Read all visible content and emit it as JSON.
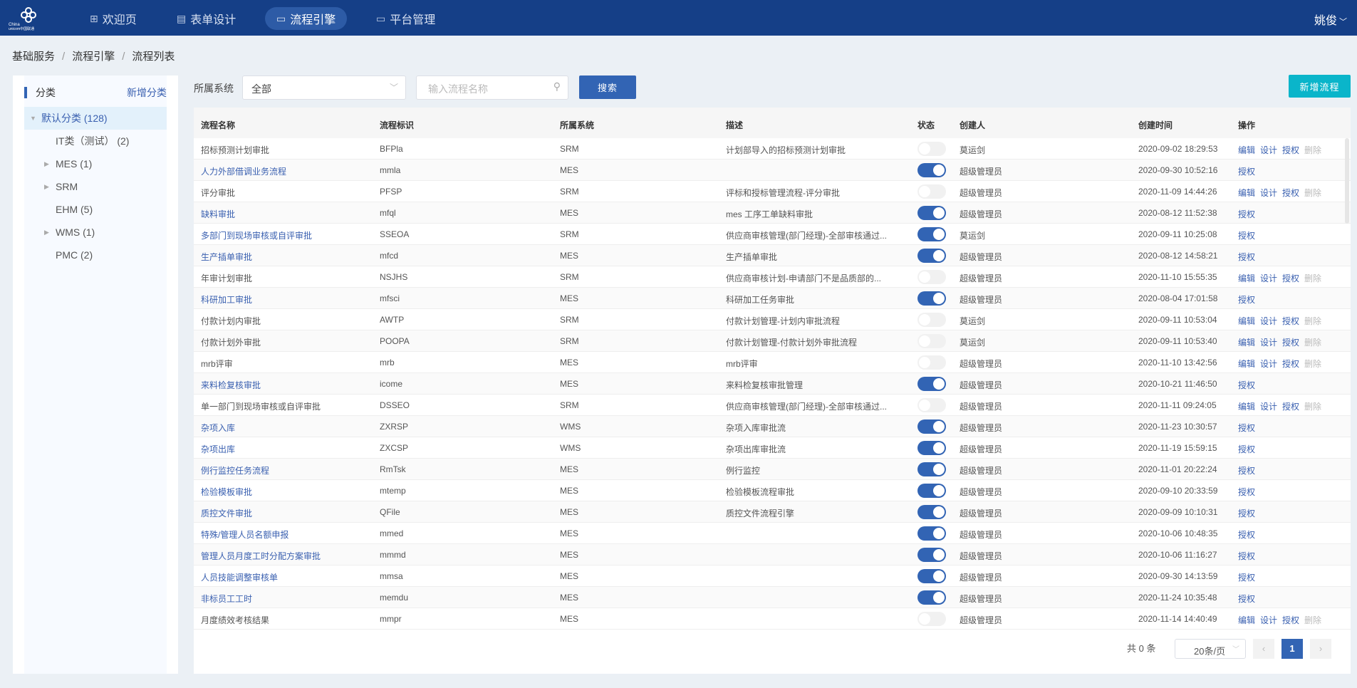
{
  "header": {
    "logo_text": "China unicom中国联通",
    "nav": [
      {
        "label": "欢迎页",
        "icon": "grid-icon"
      },
      {
        "label": "表单设计",
        "icon": "form-icon"
      },
      {
        "label": "流程引擎",
        "icon": "monitor-code-icon",
        "active": true
      },
      {
        "label": "平台管理",
        "icon": "monitor-icon"
      }
    ],
    "user": "姚俊"
  },
  "breadcrumb": [
    "基础服务",
    "流程引擎",
    "流程列表"
  ],
  "sidebar": {
    "title": "分类",
    "add_label": "新增分类",
    "tree": [
      {
        "label": "默认分类 (128)",
        "expanded": true,
        "selected": true
      },
      {
        "label": "IT类（测试） (2)"
      },
      {
        "label": "MES (1)",
        "has_children": true
      },
      {
        "label": "SRM",
        "has_children": true
      },
      {
        "label": "EHM (5)"
      },
      {
        "label": "WMS (1)",
        "has_children": true
      },
      {
        "label": "PMC (2)"
      }
    ]
  },
  "toolbar": {
    "system_label": "所属系统",
    "system_value": "全部",
    "search_placeholder": "输入流程名称",
    "search_button": "搜索",
    "new_button": "新增流程"
  },
  "colors": {
    "header": "#153f87",
    "primary": "#3264b4",
    "accent": "#0ab5ca",
    "link": "#3a60b0"
  },
  "table": {
    "columns": [
      "流程名称",
      "流程标识",
      "所属系统",
      "描述",
      "状态",
      "创建人",
      "创建时间",
      "操作"
    ],
    "rows": [
      [
        "招标预测计划审批",
        "BFPla",
        "SRM",
        "计划部导入的招标预测计划审批",
        false,
        "莫运剑",
        "2020-09-02 18:29:53"
      ],
      [
        "人力外部借调业务流程",
        "mmla",
        "MES",
        "",
        true,
        "超级管理员",
        "2020-09-30 10:52:16"
      ],
      [
        "评分审批",
        "PFSP",
        "SRM",
        "评标和授标管理流程-评分审批",
        false,
        "超级管理员",
        "2020-11-09 14:44:26"
      ],
      [
        "缺料审批",
        "mfql",
        "MES",
        "mes 工序工单缺料审批",
        true,
        "超级管理员",
        "2020-08-12 11:52:38"
      ],
      [
        "多部门到现场审核或自评审批",
        "SSEOA",
        "SRM",
        "供应商审核管理(部门经理)-全部审核通过...",
        true,
        "莫运剑",
        "2020-09-11 10:25:08"
      ],
      [
        "生产插单审批",
        "mfcd",
        "MES",
        "生产插单审批",
        true,
        "超级管理员",
        "2020-08-12 14:58:21"
      ],
      [
        "年审计划审批",
        "NSJHS",
        "SRM",
        "供应商审核计划-申请部门不是品质部的...",
        false,
        "超级管理员",
        "2020-11-10 15:55:35"
      ],
      [
        "科研加工审批",
        "mfsci",
        "MES",
        "科研加工任务审批",
        true,
        "超级管理员",
        "2020-08-04 17:01:58"
      ],
      [
        "付款计划内审批",
        "AWTP",
        "SRM",
        "付款计划管理-计划内审批流程",
        false,
        "莫运剑",
        "2020-09-11 10:53:04"
      ],
      [
        "付款计划外审批",
        "POOPA",
        "SRM",
        "付款计划管理-付款计划外审批流程",
        false,
        "莫运剑",
        "2020-09-11 10:53:40"
      ],
      [
        "mrb评审",
        "mrb",
        "MES",
        "mrb评审",
        false,
        "超级管理员",
        "2020-11-10 13:42:56"
      ],
      [
        "来料检复核审批",
        "icome",
        "MES",
        "来料检复核审批管理",
        true,
        "超级管理员",
        "2020-10-21 11:46:50"
      ],
      [
        "单一部门到现场审核或自评审批",
        "DSSEO",
        "SRM",
        "供应商审核管理(部门经理)-全部审核通过...",
        false,
        "超级管理员",
        "2020-11-11 09:24:05"
      ],
      [
        "杂项入库",
        "ZXRSP",
        "WMS",
        "杂项入库审批流",
        true,
        "超级管理员",
        "2020-11-23 10:30:57"
      ],
      [
        "杂项出库",
        "ZXCSP",
        "WMS",
        "杂项出库审批流",
        true,
        "超级管理员",
        "2020-11-19 15:59:15"
      ],
      [
        "例行监控任务流程",
        "RmTsk",
        "MES",
        "例行监控",
        true,
        "超级管理员",
        "2020-11-01 20:22:24"
      ],
      [
        "检验模板审批",
        "mtemp",
        "MES",
        "检验模板流程审批",
        true,
        "超级管理员",
        "2020-09-10 20:33:59"
      ],
      [
        "质控文件审批",
        "QFile",
        "MES",
        "质控文件流程引擎",
        true,
        "超级管理员",
        "2020-09-09 10:10:31"
      ],
      [
        "特殊/管理人员名额申报",
        "mmed",
        "MES",
        "",
        true,
        "超级管理员",
        "2020-10-06 10:48:35"
      ],
      [
        "管理人员月度工时分配方案审批",
        "mmmd",
        "MES",
        "",
        true,
        "超级管理员",
        "2020-10-06 11:16:27"
      ],
      [
        "人员技能调整审核单",
        "mmsa",
        "MES",
        "",
        true,
        "超级管理员",
        "2020-09-30 14:13:59"
      ],
      [
        "非标员工工时",
        "memdu",
        "MES",
        "",
        true,
        "超级管理员",
        "2020-11-24 10:35:48"
      ],
      [
        "月度绩效考核结果",
        "mmpr",
        "MES",
        "",
        false,
        "超级管理员",
        "2020-11-14 14:40:49"
      ]
    ],
    "ops_full": [
      "编辑",
      "设计",
      "授权",
      "删除"
    ],
    "ops_enabled": [
      "授权"
    ]
  },
  "pagination": {
    "total": "共 0 条",
    "page_size": "20条/页",
    "current": "1"
  }
}
